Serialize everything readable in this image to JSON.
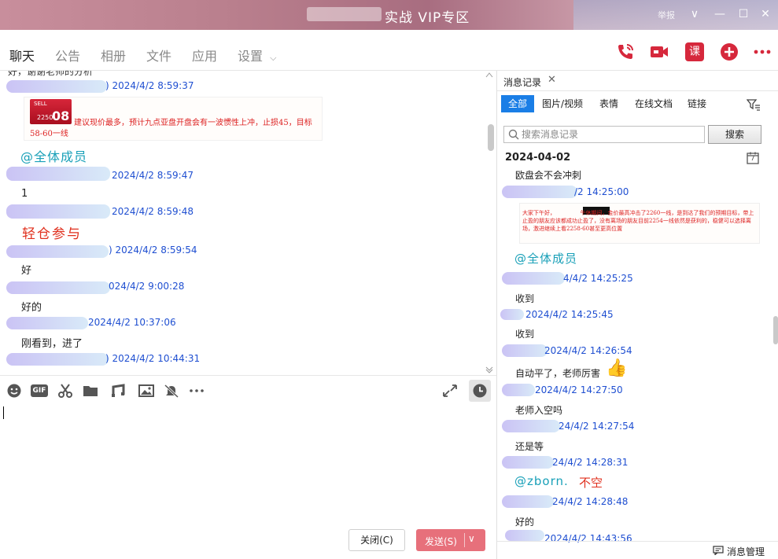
{
  "window": {
    "title": "实战 VIP专区",
    "mark": "举报",
    "controls": {
      "chevron": "∨",
      "minimize": "—",
      "maximize": "☐",
      "close": "✕"
    }
  },
  "toolbar": {
    "tabs": [
      "聊天",
      "公告",
      "相册",
      "文件",
      "应用",
      "设置"
    ],
    "settings_arrow": "⌵",
    "icons": [
      "phone-icon",
      "video-icon",
      "lesson-icon",
      "add-icon",
      "more-icon"
    ],
    "lesson_label": "课",
    "accent_color": "#d6283c"
  },
  "chat": {
    "top_cut_text": "好，谢谢老师的分析",
    "image_card": {
      "sell_label": "SELL",
      "price_small": "2250",
      "price_big": "08",
      "text": "建议现价最多，预计九点亚盘开盘会有一波惯性上冲，止损45，目标58-60一线"
    },
    "messages": [
      {
        "ts": ") 2024/4/2 8:59:37"
      },
      {
        "ts": "2024/4/2 8:59:47",
        "text": "@全体成员"
      },
      {
        "ts": "2024/4/2 8:59:48",
        "text": "1"
      },
      {
        "ts": ") 2024/4/2 8:59:54",
        "text": "轻仓参与"
      },
      {
        "ts": "024/4/2 9:00:28",
        "text": "好"
      },
      {
        "ts": "2024/4/2 10:37:06",
        "text": "好的"
      },
      {
        "ts": ") 2024/4/2 10:44:31",
        "text": "刚看到，进了"
      }
    ]
  },
  "input": {
    "icons": [
      "emoji-icon",
      "gif-icon",
      "scissors-icon",
      "folder-icon",
      "music-icon",
      "image-icon",
      "bell-off-icon",
      "more-icon"
    ],
    "gif_label": "GIF",
    "close_button": "关闭(C)",
    "send_button": "发送(S)",
    "send_arrow": "∨"
  },
  "history": {
    "tab_label": "消息记录",
    "tab_close": "✕",
    "filters": [
      "全部",
      "图片/视频",
      "表情",
      "在线文档",
      "链接"
    ],
    "search_placeholder": "搜索消息记录",
    "search_button": "搜索",
    "date": "2024-04-02",
    "cal_day": "7",
    "first_msg": "欧盘会不会冲刺",
    "image_text": "大家下午好，　　　　　午休期间，金价最高冲击了2260一线，是到达了我们的预期目标，带上止盈的朋友应该都成功止盈了，没有离场的朋友目前2254一线依然是获利的，稳健可以选择离场，激进继续上看2258-60甚至更高位置",
    "items": [
      {
        "ts": "/2 14:25:00"
      },
      {
        "ts": "4/4/2 14:25:25",
        "text": "@全体成员"
      },
      {
        "ts": "2024/4/2 14:25:45",
        "text": "收到"
      },
      {
        "ts": "2024/4/2 14:26:54",
        "text": "收到"
      },
      {
        "ts": "2024/4/2 14:27:50",
        "text": "自动平了，老师厉害"
      },
      {
        "ts": "24/4/2 14:27:54",
        "text": "老师入空吗"
      },
      {
        "ts": "24/4/2 14:28:31",
        "text": "还是等"
      },
      {
        "ts": "24/4/2 14:28:48",
        "text": "@zborn.",
        "text2": "不空"
      },
      {
        "ts": "2024/4/2 14:43:56",
        "text": "好的"
      }
    ],
    "manage_label": "消息管理"
  }
}
